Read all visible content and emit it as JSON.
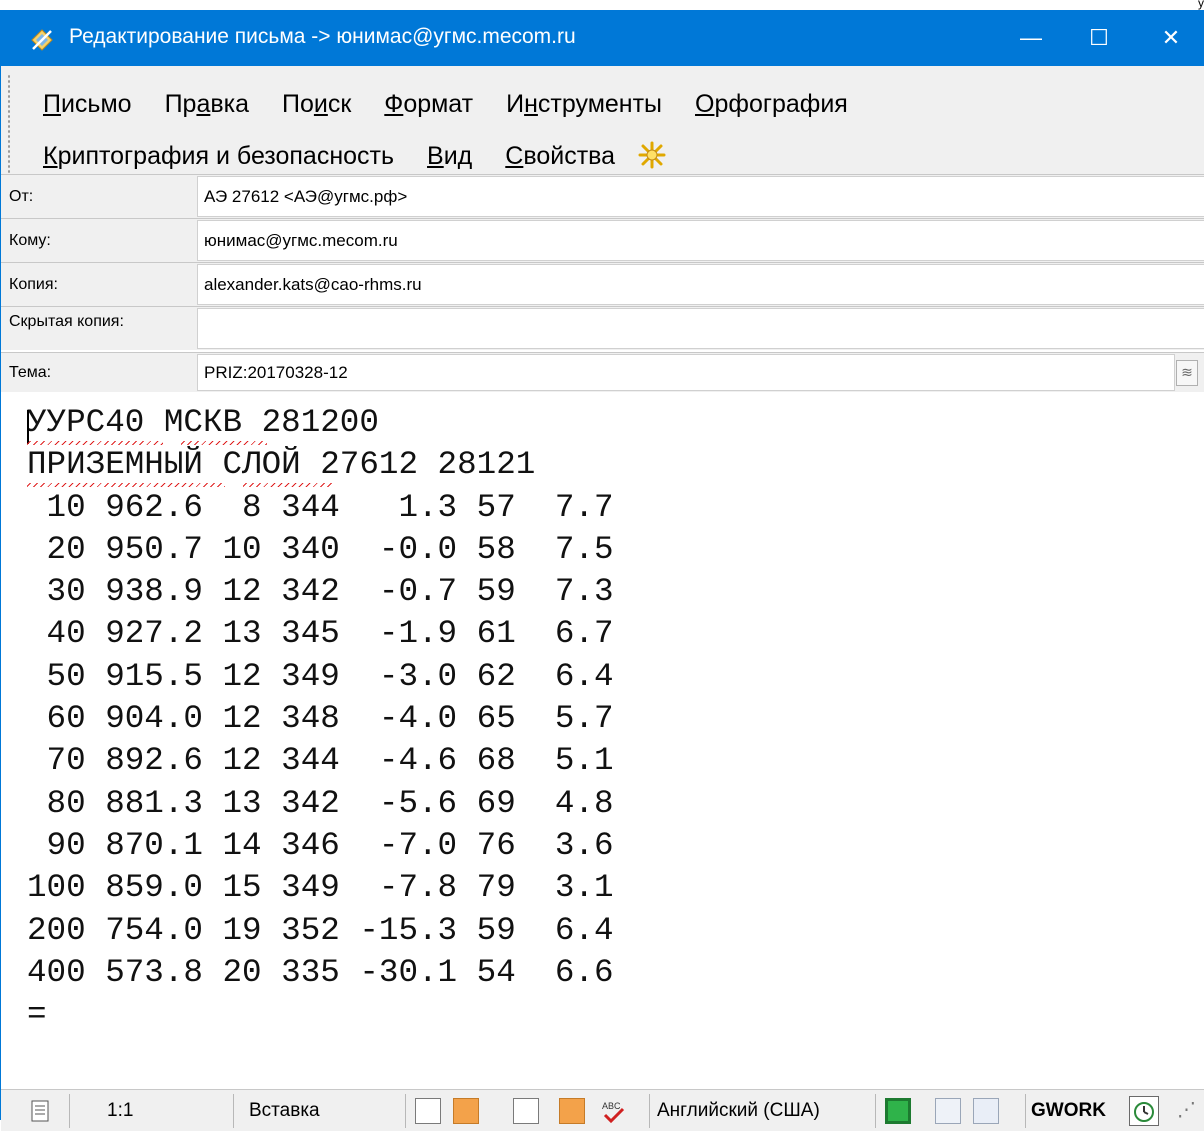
{
  "window": {
    "title": "Редактирование письма -> юнимас@угмс.mecom.ru",
    "minimize_glyph": "—",
    "maximize_glyph": "☐",
    "close_glyph": "✕",
    "corner_text": "у"
  },
  "menu": {
    "row1": [
      {
        "pre": "",
        "key": "П",
        "post": "исьмо"
      },
      {
        "pre": "Пр",
        "key": "а",
        "post": "вка"
      },
      {
        "pre": "По",
        "key": "и",
        "post": "ск"
      },
      {
        "pre": "",
        "key": "Ф",
        "post": "ормат"
      },
      {
        "pre": "И",
        "key": "н",
        "post": "струменты"
      },
      {
        "pre": "",
        "key": "О",
        "post": "рфография"
      }
    ],
    "row2": [
      {
        "pre": "",
        "key": "К",
        "post": "риптография и безопасность"
      },
      {
        "pre": "",
        "key": "В",
        "post": "ид"
      },
      {
        "pre": "",
        "key": "С",
        "post": "войства"
      }
    ]
  },
  "headers": {
    "from_label": "От:",
    "from_value": "АЭ 27612 <АЭ@угмс.рф>",
    "to_label": "Кому:",
    "to_value": "юнимас@угмс.mecom.ru",
    "cc_label": "Копия:",
    "cc_value": "alexander.kats@cao-rhms.ru",
    "bcc_label": "Скрытая копия:",
    "bcc_value": "",
    "subject_label": "Тема:",
    "subject_value": "PRIZ:20170328-12"
  },
  "body_text": "УУРС40 МСКВ 281200\nПРИЗЕМНЫЙ СЛОЙ 27612 28121\n 10 962.6  8 344   1.3 57  7.7\n 20 950.7 10 340  -0.0 58  7.5\n 30 938.9 12 342  -0.7 59  7.3\n 40 927.2 13 345  -1.9 61  6.7\n 50 915.5 12 349  -3.0 62  6.4\n 60 904.0 12 348  -4.0 65  5.7\n 70 892.6 12 344  -4.6 68  5.1\n 80 881.3 13 342  -5.6 69  4.8\n 90 870.1 14 346  -7.0 76  3.6\n100 859.0 15 349  -7.8 79  3.1\n200 754.0 19 352 -15.3 59  6.4\n400 573.8 20 335 -30.1 54  6.6\n=",
  "status": {
    "position": "1:1",
    "mode": "Вставка",
    "language": "Английский (США)",
    "profile": "GWORK"
  },
  "colors": {
    "titlebar": "#0078d7",
    "chrome": "#f0f0f0",
    "spell_error": "#e02020",
    "toggle_on": "#f3a24a"
  }
}
